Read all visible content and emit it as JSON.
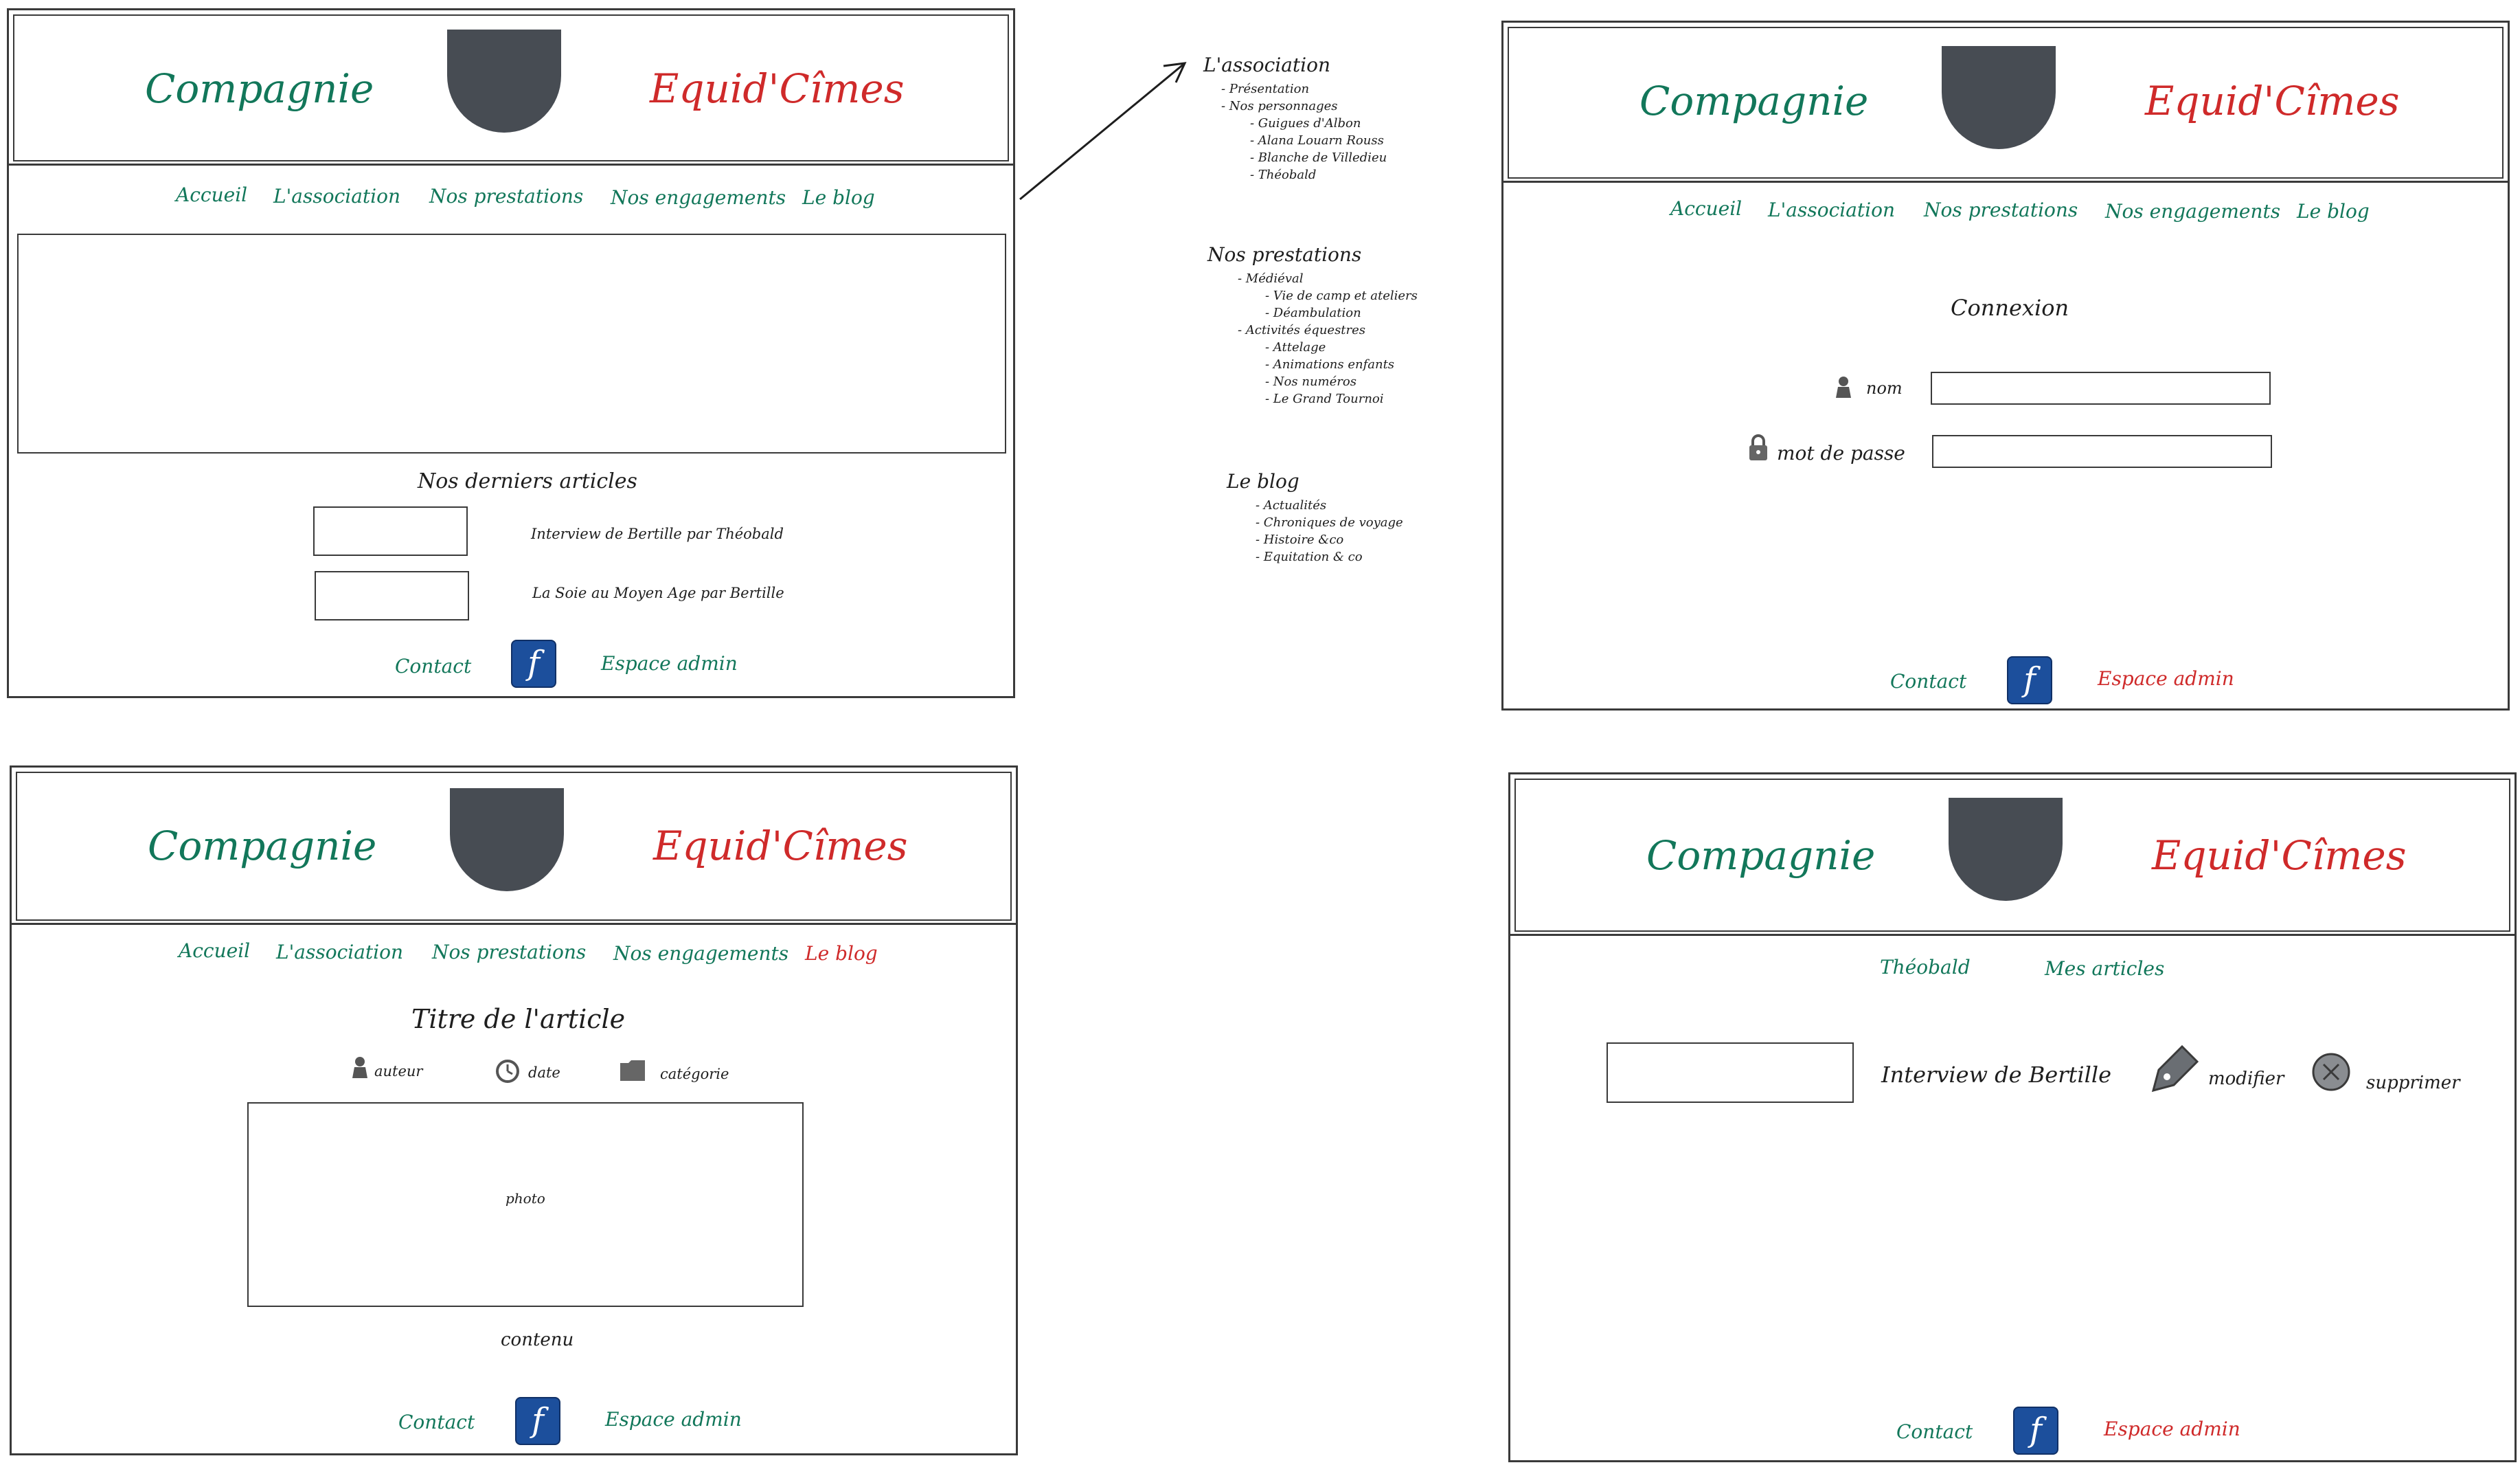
{
  "brand": {
    "left": "Compagnie",
    "right": "Equid'Cîmes"
  },
  "nav": [
    "Accueil",
    "L'association",
    "Nos prestations",
    "Nos engagements",
    "Le blog"
  ],
  "footer": {
    "contact": "Contact",
    "facebook": "f",
    "admin": "Espace admin"
  },
  "home": {
    "latest_title": "Nos derniers articles",
    "articles": [
      "Interview de Bertille par Théobald",
      "La Soie au Moyen Age par Bertille"
    ]
  },
  "sitemap": {
    "association": {
      "title": "L'association",
      "items": [
        "- Présentation",
        "- Nos personnages",
        "- Guigues d'Albon",
        "- Alana Louarn Rouss",
        "- Blanche de Villedieu",
        "- Théobald"
      ]
    },
    "prestations": {
      "title": "Nos prestations",
      "items": [
        "- Médiéval",
        "- Vie de camp et ateliers",
        "- Déambulation",
        "- Activités équestres",
        "- Attelage",
        "- Animations enfants",
        "- Nos numéros",
        "- Le Grand Tournoi"
      ]
    },
    "blog": {
      "title": "Le blog",
      "items": [
        "- Actualités",
        "- Chroniques de voyage",
        "- Histoire &co",
        "- Equitation & co"
      ]
    }
  },
  "login": {
    "title": "Connexion",
    "name_label": "nom",
    "password_label": "mot de passe"
  },
  "article": {
    "title": "Titre de l'article",
    "author": "auteur",
    "date": "date",
    "category": "catégorie",
    "photo": "photo",
    "content": "contenu"
  },
  "admin": {
    "nav": [
      "Théobald",
      "Mes articles"
    ],
    "article_title": "Interview de Bertille",
    "edit": "modifier",
    "delete": "supprimer"
  },
  "colors": {
    "green": "#12775a",
    "red": "#cf2a2a",
    "shield": "#474c53",
    "facebook": "#1c4f9c"
  }
}
